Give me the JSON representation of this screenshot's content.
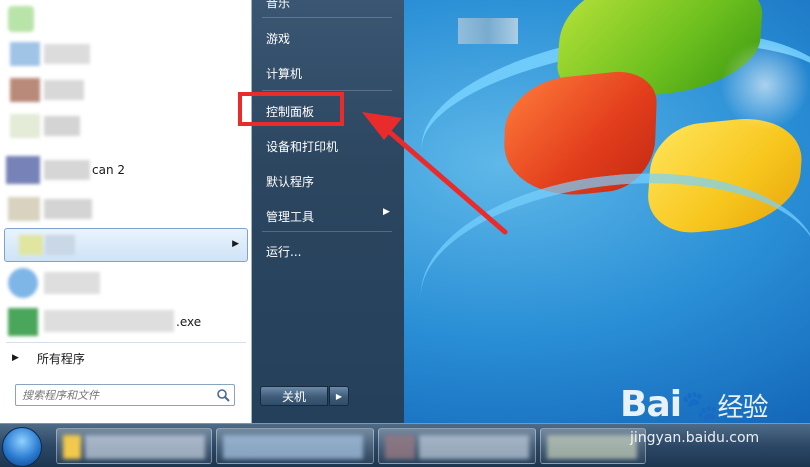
{
  "start_menu": {
    "left": {
      "scan_label_suffix": "can 2",
      "exe_label_suffix": ".exe",
      "all_programs": "所有程序",
      "search_placeholder": "搜索程序和文件"
    },
    "right": {
      "items": [
        {
          "label": "音乐"
        },
        {
          "label": "游戏"
        },
        {
          "label": "计算机"
        },
        {
          "label": "控制面板"
        },
        {
          "label": "设备和打印机"
        },
        {
          "label": "默认程序"
        },
        {
          "label": "管理工具"
        },
        {
          "label": "运行..."
        }
      ]
    },
    "shutdown_label": "关机"
  },
  "watermark": {
    "brand": "Bai",
    "brand_suffix": "经验",
    "url": "jingyan.baidu.com"
  },
  "colors": {
    "annotation": "#ea2b2b",
    "right_pane": "#2c4660"
  }
}
